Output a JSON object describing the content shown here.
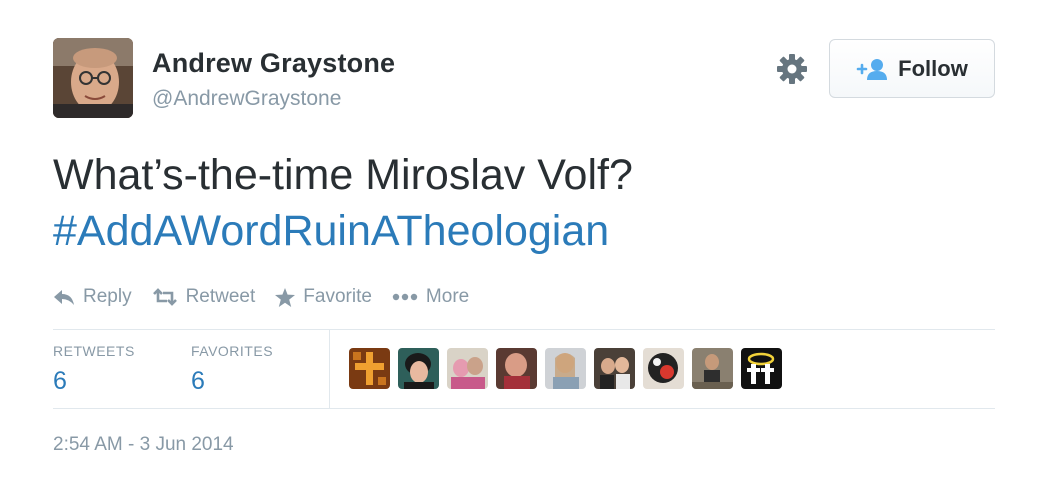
{
  "user": {
    "name": "Andrew Graystone",
    "handle": "@AndrewGraystone"
  },
  "header": {
    "settings_icon": "gear-icon",
    "follow_label": "Follow",
    "follow_icon": "add-user-icon"
  },
  "tweet": {
    "text": "What’s-the-time Miroslav Volf?",
    "hashtag": "#AddAWordRuinATheologian"
  },
  "actions": [
    {
      "label": "Reply",
      "icon": "reply-icon"
    },
    {
      "label": "Retweet",
      "icon": "retweet-icon"
    },
    {
      "label": "Favorite",
      "icon": "star-icon"
    },
    {
      "label": "More",
      "icon": "more-dots-icon"
    }
  ],
  "stats": {
    "retweets_label": "RETWEETS",
    "retweets_count": "6",
    "favorites_label": "FAVORITES",
    "favorites_count": "6"
  },
  "timestamp": "2:54 AM - 3 Jun 2014",
  "colors": {
    "text": "#292f33",
    "muted": "#8899a6",
    "link": "#2b7bb9",
    "divider": "#e1e8ed"
  }
}
